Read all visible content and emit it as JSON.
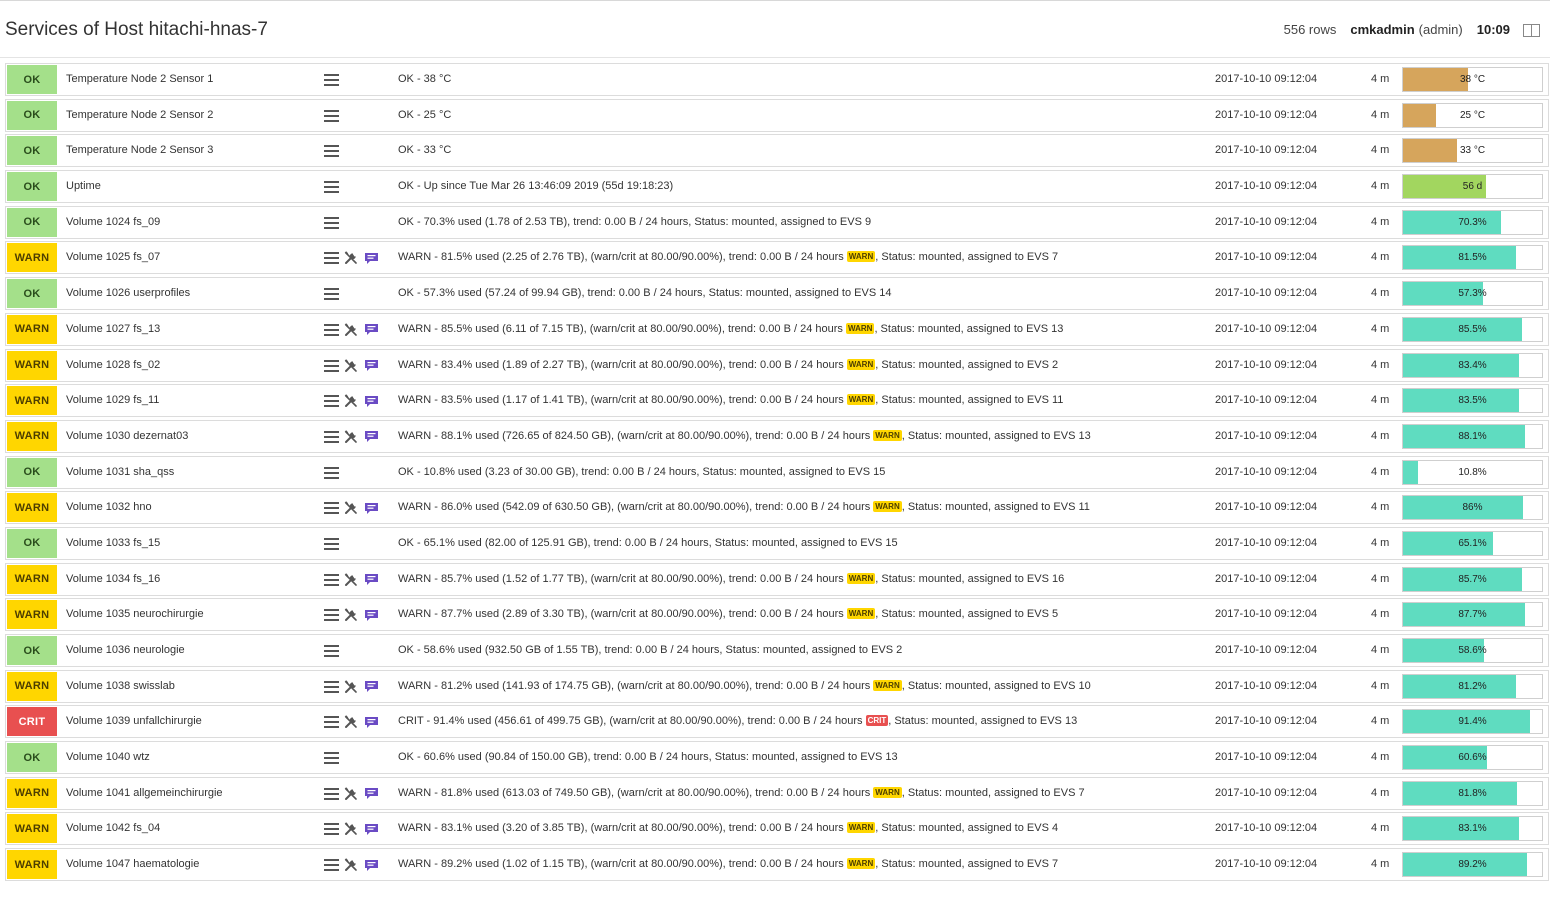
{
  "header": {
    "title": "Services of Host hitachi-hnas-7",
    "rows": "556 rows",
    "user": "cmkadmin",
    "role": "(admin)",
    "time": "10:09"
  },
  "colors": {
    "ok": "#a4e08a",
    "warn": "#ffd600",
    "crit": "#e85050",
    "temp_bar": "#d6a55c",
    "uptime_bar": "#a2d65f",
    "volume_bar": "#5fdcc0"
  },
  "services": [
    {
      "state": "OK",
      "name": "Temperature Node 2 Sensor 1",
      "output": "OK - 38 °C",
      "badge": "",
      "output_tail": "",
      "time": "2017-10-10 09:12:04",
      "age": "4 m",
      "perf_label": "38 °C",
      "perf_value": 0.47,
      "perf_color": "#d6a55c",
      "actions": false
    },
    {
      "state": "OK",
      "name": "Temperature Node 2 Sensor 2",
      "output": "OK - 25 °C",
      "badge": "",
      "output_tail": "",
      "time": "2017-10-10 09:12:04",
      "age": "4 m",
      "perf_label": "25 °C",
      "perf_value": 0.24,
      "perf_color": "#d6a55c",
      "actions": false
    },
    {
      "state": "OK",
      "name": "Temperature Node 2 Sensor 3",
      "output": "OK - 33 °C",
      "badge": "",
      "output_tail": "",
      "time": "2017-10-10 09:12:04",
      "age": "4 m",
      "perf_label": "33 °C",
      "perf_value": 0.39,
      "perf_color": "#d6a55c",
      "actions": false
    },
    {
      "state": "OK",
      "name": "Uptime",
      "output": "OK - Up since Tue Mar 26 13:46:09 2019 (55d 19:18:23)",
      "badge": "",
      "output_tail": "",
      "time": "2017-10-10 09:12:04",
      "age": "4 m",
      "perf_label": "56 d",
      "perf_value": 0.6,
      "perf_color": "#a2d65f",
      "actions": false
    },
    {
      "state": "OK",
      "name": "Volume 1024 fs_09",
      "output": "OK - 70.3% used (1.78 of 2.53 TB), trend: 0.00 B / 24 hours, Status: mounted, assigned to EVS 9",
      "badge": "",
      "output_tail": "",
      "time": "2017-10-10 09:12:04",
      "age": "4 m",
      "perf_label": "70.3%",
      "perf_value": 0.703,
      "perf_color": "#5fdcc0",
      "actions": false
    },
    {
      "state": "WARN",
      "name": "Volume 1025 fs_07",
      "output": "WARN - 81.5% used (2.25 of 2.76 TB), (warn/crit at 80.00/90.00%), trend: 0.00 B / 24 hours",
      "badge": "WARN",
      "output_tail": ", Status: mounted, assigned to EVS 7",
      "time": "2017-10-10 09:12:04",
      "age": "4 m",
      "perf_label": "81.5%",
      "perf_value": 0.815,
      "perf_color": "#5fdcc0",
      "actions": true
    },
    {
      "state": "OK",
      "name": "Volume 1026 userprofiles",
      "output": "OK - 57.3% used (57.24 of 99.94 GB), trend: 0.00 B / 24 hours, Status: mounted, assigned to EVS 14",
      "badge": "",
      "output_tail": "",
      "time": "2017-10-10 09:12:04",
      "age": "4 m",
      "perf_label": "57.3%",
      "perf_value": 0.573,
      "perf_color": "#5fdcc0",
      "actions": false
    },
    {
      "state": "WARN",
      "name": "Volume 1027 fs_13",
      "output": "WARN - 85.5% used (6.11 of 7.15 TB), (warn/crit at 80.00/90.00%), trend: 0.00 B / 24 hours",
      "badge": "WARN",
      "output_tail": ", Status: mounted, assigned to EVS 13",
      "time": "2017-10-10 09:12:04",
      "age": "4 m",
      "perf_label": "85.5%",
      "perf_value": 0.855,
      "perf_color": "#5fdcc0",
      "actions": true
    },
    {
      "state": "WARN",
      "name": "Volume 1028 fs_02",
      "output": "WARN - 83.4% used (1.89 of 2.27 TB), (warn/crit at 80.00/90.00%), trend: 0.00 B / 24 hours",
      "badge": "WARN",
      "output_tail": ", Status: mounted, assigned to EVS 2",
      "time": "2017-10-10 09:12:04",
      "age": "4 m",
      "perf_label": "83.4%",
      "perf_value": 0.834,
      "perf_color": "#5fdcc0",
      "actions": true
    },
    {
      "state": "WARN",
      "name": "Volume 1029 fs_11",
      "output": "WARN - 83.5% used (1.17 of 1.41 TB), (warn/crit at 80.00/90.00%), trend: 0.00 B / 24 hours",
      "badge": "WARN",
      "output_tail": ", Status: mounted, assigned to EVS 11",
      "time": "2017-10-10 09:12:04",
      "age": "4 m",
      "perf_label": "83.5%",
      "perf_value": 0.835,
      "perf_color": "#5fdcc0",
      "actions": true
    },
    {
      "state": "WARN",
      "name": "Volume 1030 dezernat03",
      "output": "WARN - 88.1% used (726.65 of 824.50 GB), (warn/crit at 80.00/90.00%), trend: 0.00 B / 24 hours",
      "badge": "WARN",
      "output_tail": ", Status: mounted, assigned to EVS 13",
      "time": "2017-10-10 09:12:04",
      "age": "4 m",
      "perf_label": "88.1%",
      "perf_value": 0.881,
      "perf_color": "#5fdcc0",
      "actions": true
    },
    {
      "state": "OK",
      "name": "Volume 1031 sha_qss",
      "output": "OK - 10.8% used (3.23 of 30.00 GB), trend: 0.00 B / 24 hours, Status: mounted, assigned to EVS 15",
      "badge": "",
      "output_tail": "",
      "time": "2017-10-10 09:12:04",
      "age": "4 m",
      "perf_label": "10.8%",
      "perf_value": 0.108,
      "perf_color": "#5fdcc0",
      "actions": false
    },
    {
      "state": "WARN",
      "name": "Volume 1032 hno",
      "output": "WARN - 86.0% used (542.09 of 630.50 GB), (warn/crit at 80.00/90.00%), trend: 0.00 B / 24 hours",
      "badge": "WARN",
      "output_tail": ", Status: mounted, assigned to EVS 11",
      "time": "2017-10-10 09:12:04",
      "age": "4 m",
      "perf_label": "86%",
      "perf_value": 0.86,
      "perf_color": "#5fdcc0",
      "actions": true
    },
    {
      "state": "OK",
      "name": "Volume 1033 fs_15",
      "output": "OK - 65.1% used (82.00 of 125.91 GB), trend: 0.00 B / 24 hours, Status: mounted, assigned to EVS 15",
      "badge": "",
      "output_tail": "",
      "time": "2017-10-10 09:12:04",
      "age": "4 m",
      "perf_label": "65.1%",
      "perf_value": 0.651,
      "perf_color": "#5fdcc0",
      "actions": false
    },
    {
      "state": "WARN",
      "name": "Volume 1034 fs_16",
      "output": "WARN - 85.7% used (1.52 of 1.77 TB), (warn/crit at 80.00/90.00%), trend: 0.00 B / 24 hours",
      "badge": "WARN",
      "output_tail": ", Status: mounted, assigned to EVS 16",
      "time": "2017-10-10 09:12:04",
      "age": "4 m",
      "perf_label": "85.7%",
      "perf_value": 0.857,
      "perf_color": "#5fdcc0",
      "actions": true
    },
    {
      "state": "WARN",
      "name": "Volume 1035 neurochirurgie",
      "output": "WARN - 87.7% used (2.89 of 3.30 TB), (warn/crit at 80.00/90.00%), trend: 0.00 B / 24 hours",
      "badge": "WARN",
      "output_tail": ", Status: mounted, assigned to EVS 5",
      "time": "2017-10-10 09:12:04",
      "age": "4 m",
      "perf_label": "87.7%",
      "perf_value": 0.877,
      "perf_color": "#5fdcc0",
      "actions": true
    },
    {
      "state": "OK",
      "name": "Volume 1036 neurologie",
      "output": "OK - 58.6% used (932.50 GB of 1.55 TB), trend: 0.00 B / 24 hours, Status: mounted, assigned to EVS 2",
      "badge": "",
      "output_tail": "",
      "time": "2017-10-10 09:12:04",
      "age": "4 m",
      "perf_label": "58.6%",
      "perf_value": 0.586,
      "perf_color": "#5fdcc0",
      "actions": false
    },
    {
      "state": "WARN",
      "name": "Volume 1038 swisslab",
      "output": "WARN - 81.2% used (141.93 of 174.75 GB), (warn/crit at 80.00/90.00%), trend: 0.00 B / 24 hours",
      "badge": "WARN",
      "output_tail": ", Status: mounted, assigned to EVS 10",
      "time": "2017-10-10 09:12:04",
      "age": "4 m",
      "perf_label": "81.2%",
      "perf_value": 0.812,
      "perf_color": "#5fdcc0",
      "actions": true
    },
    {
      "state": "CRIT",
      "name": "Volume 1039 unfallchirurgie",
      "output": "CRIT - 91.4% used (456.61 of 499.75 GB), (warn/crit at 80.00/90.00%), trend: 0.00 B / 24 hours",
      "badge": "CRIT",
      "output_tail": ", Status: mounted, assigned to EVS 13",
      "time": "2017-10-10 09:12:04",
      "age": "4 m",
      "perf_label": "91.4%",
      "perf_value": 0.914,
      "perf_color": "#5fdcc0",
      "actions": true
    },
    {
      "state": "OK",
      "name": "Volume 1040 wtz",
      "output": "OK - 60.6% used (90.84 of 150.00 GB), trend: 0.00 B / 24 hours, Status: mounted, assigned to EVS 13",
      "badge": "",
      "output_tail": "",
      "time": "2017-10-10 09:12:04",
      "age": "4 m",
      "perf_label": "60.6%",
      "perf_value": 0.606,
      "perf_color": "#5fdcc0",
      "actions": false
    },
    {
      "state": "WARN",
      "name": "Volume 1041 allgemeinchirurgie",
      "output": "WARN - 81.8% used (613.03 of 749.50 GB), (warn/crit at 80.00/90.00%), trend: 0.00 B / 24 hours",
      "badge": "WARN",
      "output_tail": ", Status: mounted, assigned to EVS 7",
      "time": "2017-10-10 09:12:04",
      "age": "4 m",
      "perf_label": "81.8%",
      "perf_value": 0.818,
      "perf_color": "#5fdcc0",
      "actions": true
    },
    {
      "state": "WARN",
      "name": "Volume 1042 fs_04",
      "output": "WARN - 83.1% used (3.20 of 3.85 TB), (warn/crit at 80.00/90.00%), trend: 0.00 B / 24 hours",
      "badge": "WARN",
      "output_tail": ", Status: mounted, assigned to EVS 4",
      "time": "2017-10-10 09:12:04",
      "age": "4 m",
      "perf_label": "83.1%",
      "perf_value": 0.831,
      "perf_color": "#5fdcc0",
      "actions": true
    },
    {
      "state": "WARN",
      "name": "Volume 1047 haematologie",
      "output": "WARN - 89.2% used (1.02 of 1.15 TB), (warn/crit at 80.00/90.00%), trend: 0.00 B / 24 hours",
      "badge": "WARN",
      "output_tail": ", Status: mounted, assigned to EVS 7",
      "time": "2017-10-10 09:12:04",
      "age": "4 m",
      "perf_label": "89.2%",
      "perf_value": 0.892,
      "perf_color": "#5fdcc0",
      "actions": true
    }
  ]
}
